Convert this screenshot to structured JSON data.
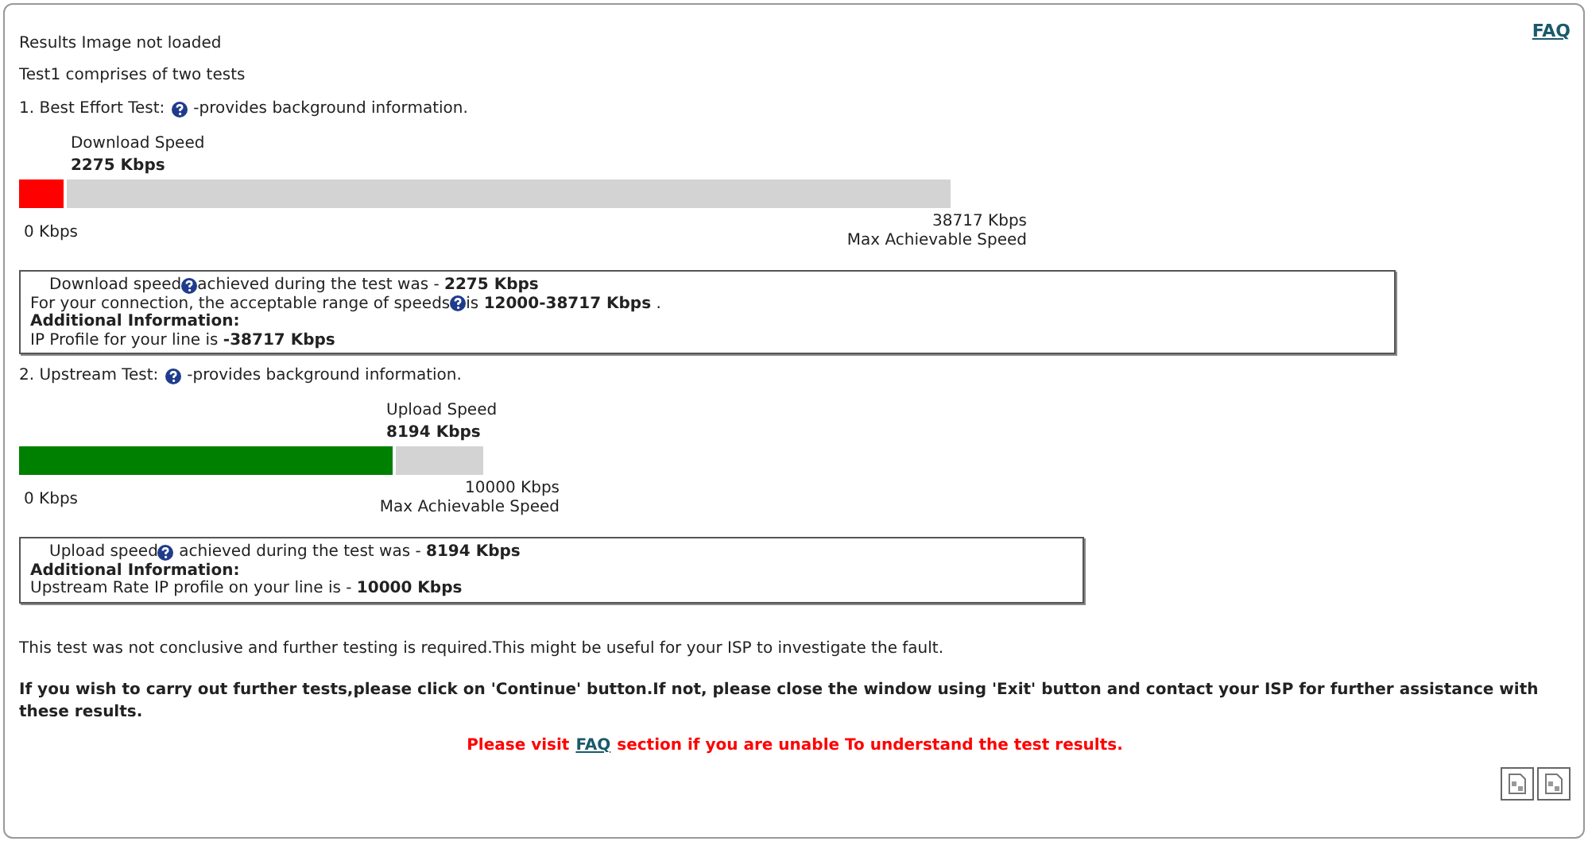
{
  "faq_link": "FAQ",
  "status": "Results Image not loaded",
  "intro": "Test1 comprises of two tests",
  "tests": [
    {
      "heading": "1. Best Effort Test:",
      "help_text": "-provides background information.",
      "gauge": {
        "label": "Download Speed",
        "value": "2275 Kbps",
        "level": 0.052,
        "color": "#ff0000",
        "min": "0 Kbps",
        "max": "38717 Kbps",
        "max_caption": "Max Achievable Speed"
      },
      "info": [
        {
          "kind": "lead",
          "before": "Download speed",
          "after": "achieved during the test was - **2275 Kbps**"
        },
        {
          "kind": "help",
          "before": "For your connection, the acceptable range of speeds",
          "after": "is **12000-38717 Kbps** ."
        },
        {
          "kind": "heading",
          "before": "Additional Information:"
        },
        {
          "kind": "plain",
          "before": "IP Profile for your line is **-38717 Kbps**"
        }
      ]
    },
    {
      "heading": "2. Upstream Test:",
      "help_text": "-provides background information.",
      "gauge": {
        "label": "Upload Speed",
        "value": "8194 Kbps",
        "level": 0.81,
        "color": "#008000",
        "min": "0 Kbps",
        "max": "10000 Kbps",
        "max_caption": "Max Achievable Speed"
      },
      "info": [
        {
          "kind": "lead",
          "before": "Upload speed",
          "after": " achieved during the test was - **8194 Kbps**"
        },
        {
          "kind": "heading",
          "before": "Additional Information:"
        },
        {
          "kind": "plain",
          "before": "Upstream Rate IP profile on your line is - **10000 Kbps**"
        }
      ]
    }
  ],
  "note": "This test was not conclusive and further testing is required.This might be useful for your ISP to investigate the fault.",
  "instruction": "If you wish to carry out further tests,please click on 'Continue' button.If not, please close the window using 'Exit' button and contact your ISP for further assistance with these results.",
  "help_line": {
    "before": "Please visit",
    "link": "FAQ",
    "after": "section if you are unable To understand the test results."
  }
}
